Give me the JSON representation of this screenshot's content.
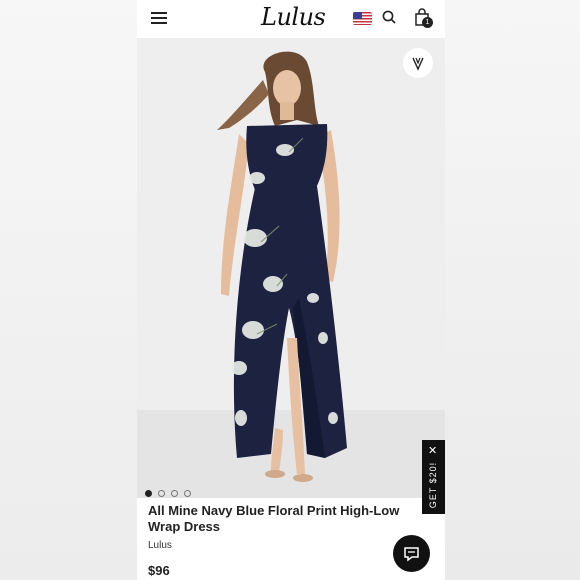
{
  "header": {
    "logo_text": "Lulus",
    "cart_count": "1"
  },
  "product": {
    "title": "All Mine Navy Blue Floral Print High-Low Wrap Dress",
    "brand": "Lulus",
    "price": "$96"
  },
  "gallery": {
    "total_images": 4,
    "active_index": 0
  },
  "promo": {
    "label": "GET $20!"
  },
  "icons": [
    "hamburger-icon",
    "us-flag-icon",
    "search-icon",
    "shopping-bag-icon",
    "favorite-logo-icon",
    "close-icon",
    "chat-icon"
  ],
  "colors": {
    "dress_navy": "#1c2240",
    "text_dark": "#222222",
    "promo_bg": "#111111"
  }
}
